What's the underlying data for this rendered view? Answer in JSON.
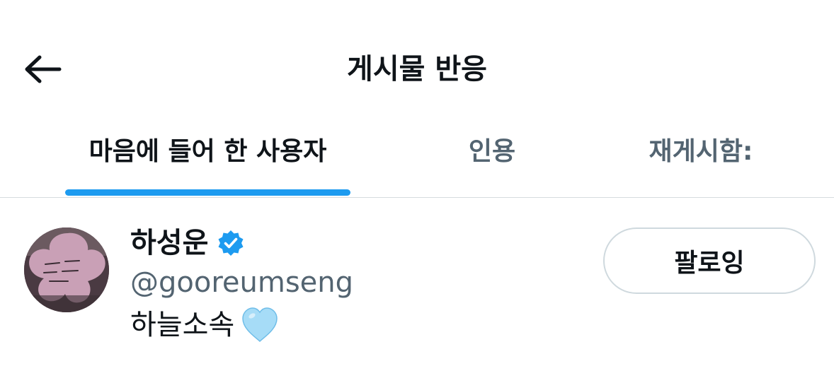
{
  "header": {
    "title": "게시물 반응"
  },
  "tabs": [
    {
      "label": "마음에 들어 한 사용자",
      "active": true
    },
    {
      "label": "인용",
      "active": false
    },
    {
      "label": "재게시함:",
      "active": false
    }
  ],
  "user": {
    "display_name": "하성운",
    "handle": "@gooreumseng",
    "bio": "하늘소속",
    "verified": true,
    "follow_label": "팔로잉"
  },
  "colors": {
    "accent": "#1d9bf0",
    "text_primary": "#0f1419",
    "text_secondary": "#536471",
    "border": "#cfd9de",
    "heart": "#a6dcf7"
  },
  "icons": {
    "back": "back-arrow-icon",
    "verified": "verified-badge-icon",
    "bio_emoji": "light-blue-heart-icon"
  }
}
